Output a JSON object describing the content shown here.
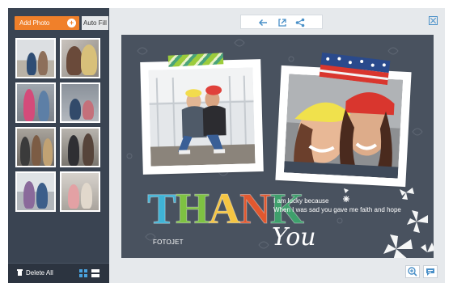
{
  "sidebar": {
    "add_photo_label": "Add Photo",
    "auto_fill_label": "Auto Fill",
    "delete_all_label": "Delete All",
    "thumbnails_count": 8
  },
  "canvas": {
    "headline": "THANK",
    "headline_colors": [
      "#3fb3d6",
      "#7ec242",
      "#f5c542",
      "#e2582f",
      "#3ea06c"
    ],
    "brand": "FOTOJET",
    "you": "You",
    "message_line1": "I am lucky because",
    "message_line2": "When I was sad you gave me faith and hope",
    "background_color": "#49525f"
  },
  "toolbar": {
    "icons": [
      "back-arrow-icon",
      "export-icon",
      "share-icon"
    ]
  },
  "colors": {
    "accent": "#f0802a",
    "link_blue": "#4a90c8",
    "sidebar_bg": "#3a4452"
  }
}
